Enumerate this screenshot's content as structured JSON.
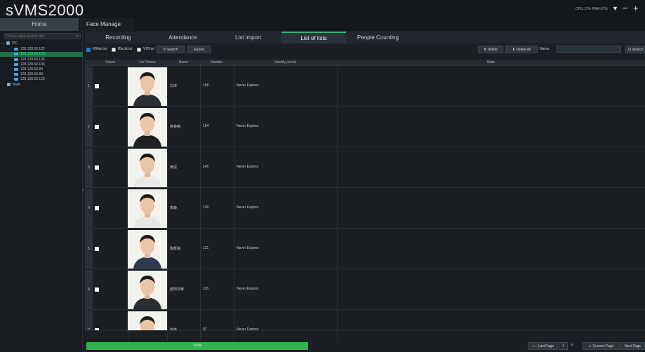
{
  "app": {
    "title": "sVMS2000",
    "sysinfo": "CPU:17%  RAM:67%"
  },
  "main_tabs": [
    {
      "label": "Home"
    },
    {
      "label": "Face Manage"
    }
  ],
  "sidebar": {
    "search_placeholder": "Please input search info",
    "tree": [
      {
        "label": "IPC",
        "type": "folder",
        "selected": false
      },
      {
        "label": "128.128.60.122",
        "type": "camera",
        "selected": false
      },
      {
        "label": "128.128.60.123",
        "type": "camera",
        "selected": true
      },
      {
        "label": "128.128.60.135",
        "type": "camera",
        "selected": false
      },
      {
        "label": "128.128.60.136",
        "type": "camera",
        "selected": false
      },
      {
        "label": "128.128.60.84",
        "type": "camera",
        "selected": false
      },
      {
        "label": "128.128.60.89",
        "type": "camera",
        "selected": false
      },
      {
        "label": "128.128.60.128",
        "type": "camera",
        "selected": false
      },
      {
        "label": "NVR",
        "type": "folder",
        "selected": false
      }
    ]
  },
  "sub_tabs": [
    {
      "label": "Recording",
      "active": false
    },
    {
      "label": "Attendance",
      "active": false
    },
    {
      "label": "List import",
      "active": false
    },
    {
      "label": "List of lists",
      "active": true
    },
    {
      "label": "People Counting",
      "active": false
    }
  ],
  "toolbar": {
    "whitelist": "WhiteList",
    "blacklist": "BlackList",
    "viplist": "VIPList",
    "search": "Search",
    "export": "Export",
    "delete": "Delete",
    "delete_all": "Delete All",
    "name_label": "Name:",
    "search_right": "Q Search"
  },
  "table": {
    "columns": [
      "Select",
      "Lib Picture",
      "Name",
      "Number",
      "Validity period",
      "State"
    ],
    "rows": [
      {
        "index": "1",
        "name": "刘洋",
        "number": "158",
        "validity": "Never Expires",
        "state": ""
      },
      {
        "index": "2",
        "name": "蒋春茜",
        "number": "154",
        "validity": "Never Expires",
        "state": ""
      },
      {
        "index": "3",
        "name": "黄成",
        "number": "145",
        "validity": "Never Expires",
        "state": ""
      },
      {
        "index": "4",
        "name": "李静",
        "number": "130",
        "validity": "Never Expires",
        "state": ""
      },
      {
        "index": "5",
        "name": "陈辉海",
        "number": "121",
        "validity": "Never Expires",
        "state": ""
      },
      {
        "index": "6",
        "name": "欧阳灵峰",
        "number": "116",
        "validity": "Never Expires",
        "state": ""
      },
      {
        "index": "7",
        "name": "陈峰",
        "number": "07",
        "validity": "Never Expires",
        "state": ""
      }
    ]
  },
  "footer": {
    "progress_label": "100%",
    "progress_percent": 100,
    "last_page": "Last Page",
    "page_current": "1",
    "page_total": "/5",
    "current_page": "Current Page",
    "next_page": "Next Page"
  },
  "colors": {
    "accent_green": "#30b44e",
    "selection_green": "#1f6f4a",
    "background": "#1b1f24"
  }
}
